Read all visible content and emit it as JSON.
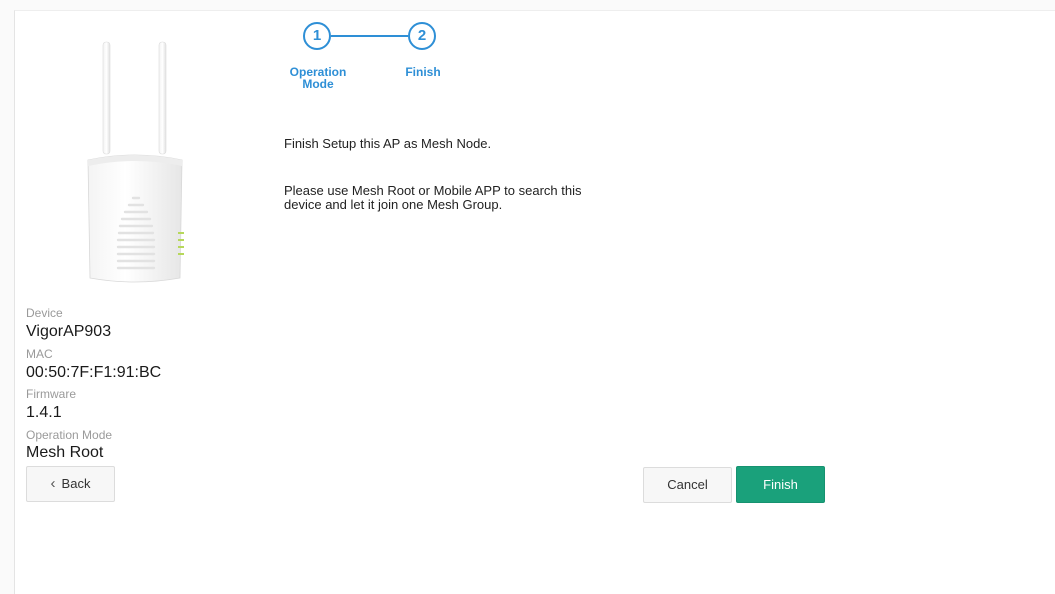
{
  "stepper": {
    "steps": [
      {
        "number": "1",
        "label_line1": "Operation",
        "label_line2": "Mode"
      },
      {
        "number": "2",
        "label_line1": "Finish",
        "label_line2": ""
      }
    ],
    "accent_color": "#2e8fd6"
  },
  "message": {
    "line1": "Finish Setup this AP as Mesh Node.",
    "line2": "Please use Mesh Root or Mobile APP to search this",
    "line3": "device and let it join one Mesh Group."
  },
  "device_image": {
    "icon": "access-point-device-icon"
  },
  "device_info": {
    "device_label": "Device",
    "device_value": "VigorAP903",
    "mac_label": "MAC",
    "mac_value": "00:50:7F:F1:91:BC",
    "firmware_label": "Firmware",
    "firmware_value": "1.4.1",
    "mode_label": "Operation Mode",
    "mode_value": "Mesh Root"
  },
  "buttons": {
    "back": "Back",
    "cancel": "Cancel",
    "finish": "Finish",
    "finish_color": "#1aa17b"
  }
}
